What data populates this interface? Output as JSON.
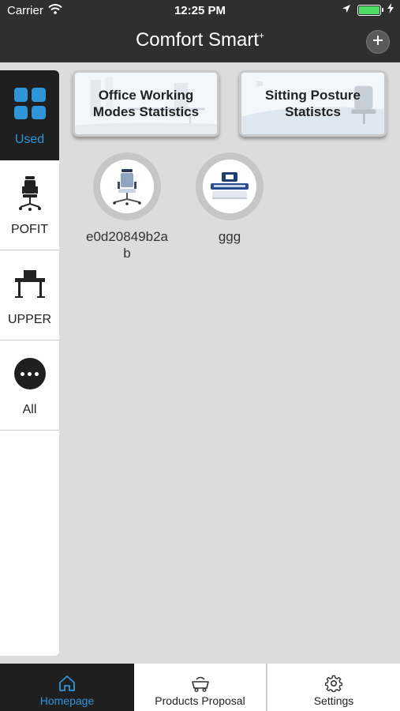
{
  "status_bar": {
    "carrier": "Carrier",
    "time": "12:25 PM"
  },
  "nav": {
    "title": "Comfort Smart",
    "title_mark": "+",
    "add_icon": "plus-icon"
  },
  "sidebar": {
    "items": [
      {
        "label": "Used",
        "icon": "grid-icon",
        "active": true
      },
      {
        "label": "POFIT",
        "icon": "office-chair-icon",
        "active": false
      },
      {
        "label": "UPPER",
        "icon": "standing-desk-icon",
        "active": false
      },
      {
        "label": "All",
        "icon": "more-dots-icon",
        "active": false
      }
    ]
  },
  "stat_cards": [
    {
      "line1": "Office Working",
      "line2": "Modes Statistics"
    },
    {
      "line1": "Sitting Posture",
      "line2": "Statistcs"
    }
  ],
  "devices": [
    {
      "name": "e0d20849b2ab",
      "icon": "office-chair-icon"
    },
    {
      "name": "ggg",
      "icon": "desk-control-icon"
    }
  ],
  "tabbar": {
    "tabs": [
      {
        "label": "Homepage",
        "icon": "home-icon",
        "active": true
      },
      {
        "label": "Products Proposal",
        "icon": "cart-icon",
        "active": false
      },
      {
        "label": "Settings",
        "icon": "gear-icon",
        "active": false
      }
    ]
  },
  "colors": {
    "accent": "#2e95d9",
    "bar_dark": "#2f2f2f",
    "battery": "#4cd964"
  }
}
